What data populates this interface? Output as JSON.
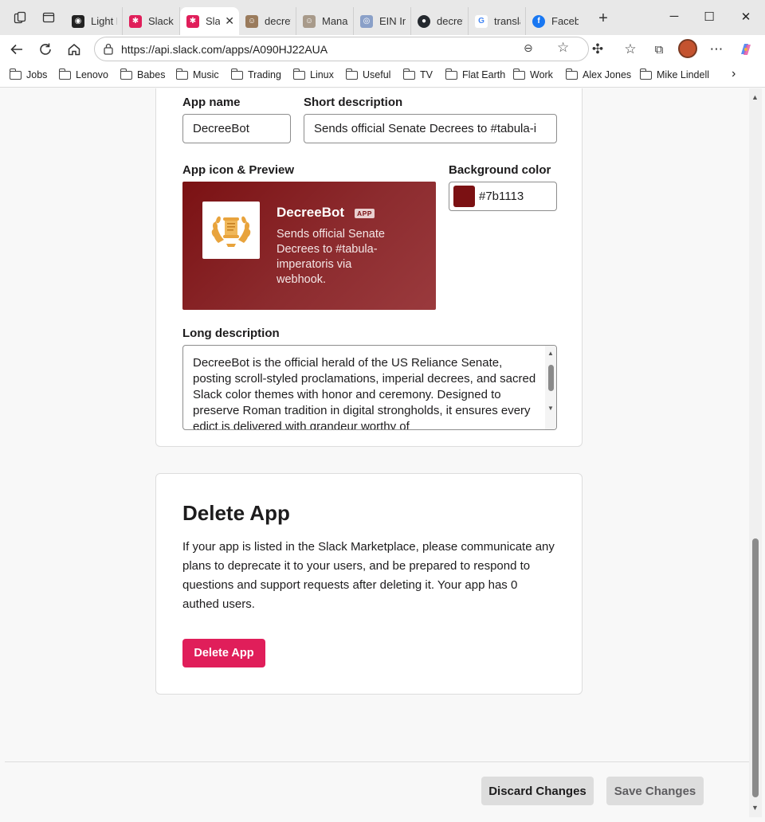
{
  "browser": {
    "tabs": [
      {
        "label": "Light F",
        "fav_color": "#222222",
        "fav_glyph": "◉"
      },
      {
        "label": "Slack A",
        "fav_color": "#e01e5a",
        "fav_glyph": "✱"
      },
      {
        "label": "Sla",
        "fav_color": "#e01e5a",
        "fav_glyph": "✱"
      },
      {
        "label": "decreta",
        "fav_color": "#9a7b5c",
        "fav_glyph": "☺"
      },
      {
        "label": "Manag",
        "fav_color": "#a89a8a",
        "fav_glyph": "☺"
      },
      {
        "label": "EIN Inc",
        "fav_color": "#8aa0c8",
        "fav_glyph": "◎"
      },
      {
        "label": "decreta",
        "fav_color": "#24292e",
        "fav_glyph": "●"
      },
      {
        "label": "translat",
        "fav_color": "#4285f4",
        "fav_glyph": "G"
      },
      {
        "label": "Facebo",
        "fav_color": "#1877f2",
        "fav_glyph": "f"
      }
    ],
    "new_tab": "+",
    "url": "https://api.slack.com/apps/A090HJ22AUA",
    "bookmarks": [
      "Jobs",
      "Lenovo",
      "Babes",
      "Music",
      "Trading",
      "Linux",
      "Useful",
      "TV",
      "Flat Earth",
      "Work",
      "Alex Jones",
      "Mike Lindell"
    ]
  },
  "form": {
    "app_name_label": "App name",
    "app_name_value": "DecreeBot",
    "short_desc_label": "Short description",
    "short_desc_value": "Sends official Senate Decrees to #tabula-i",
    "icon_preview_label": "App icon & Preview",
    "preview_name": "DecreeBot",
    "preview_badge": "APP",
    "preview_desc": "Sends official Senate Decrees to #tabula-imperatoris via webhook.",
    "bg_color_label": "Background color",
    "bg_color_value": "#7b1113",
    "long_desc_label": "Long description",
    "long_desc_value": "DecreeBot is the official herald of the US Reliance Senate, posting scroll-styled proclamations, imperial decrees, and sacred Slack color themes with honor and ceremony. Designed to preserve Roman tradition in digital strongholds, it ensures every edict is delivered with grandeur worthy of"
  },
  "delete_section": {
    "title": "Delete App",
    "text": "If your app is listed in the Slack Marketplace, please communicate any plans to deprecate it to your users, and be prepared to respond to questions and support requests after deleting it. Your app has 0 authed users.",
    "button": "Delete App"
  },
  "footer": {
    "discard": "Discard Changes",
    "save": "Save Changes"
  },
  "colors": {
    "accent_delete": "#e01e5a",
    "app_background": "#7b1113"
  }
}
